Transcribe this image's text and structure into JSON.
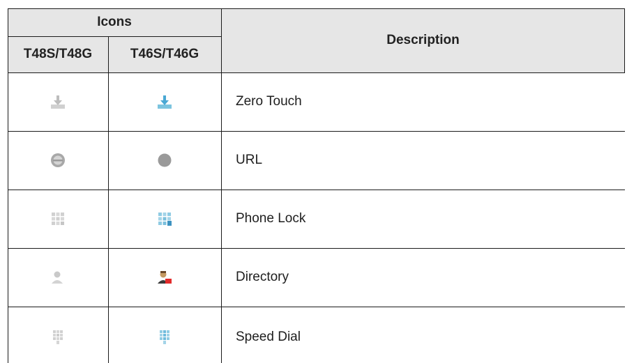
{
  "table": {
    "header": {
      "icons_label": "Icons",
      "col1_label": "T48S/T48G",
      "col2_label": "T46S/T46G",
      "description_label": "Description"
    },
    "rows": [
      {
        "t48_icon": "zero-touch-icon-gray",
        "t46_icon": "zero-touch-icon-blue",
        "description": "Zero Touch"
      },
      {
        "t48_icon": "url-icon-gray",
        "t46_icon": "url-icon-gray-dot",
        "description": "URL"
      },
      {
        "t48_icon": "phone-lock-icon-gray",
        "t46_icon": "phone-lock-icon-blue",
        "description": "Phone Lock"
      },
      {
        "t48_icon": "directory-icon-gray",
        "t46_icon": "directory-icon-color",
        "description": "Directory"
      },
      {
        "t48_icon": "speed-dial-icon-gray",
        "t46_icon": "speed-dial-icon-blue",
        "description": "Speed Dial"
      }
    ],
    "colors": {
      "header_bg": "#e6e6e6",
      "border": "#1a1a1a",
      "icon_blue": "#5fb7da",
      "icon_gray": "#b9b9b9"
    }
  }
}
